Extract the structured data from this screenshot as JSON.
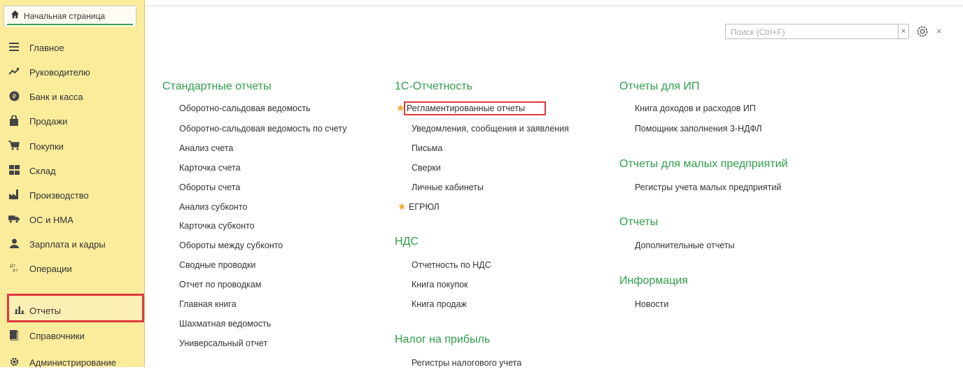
{
  "home_tab": {
    "label": "Начальная страница"
  },
  "sidebar": {
    "items": [
      {
        "label": "Главное",
        "icon": "menu-lines-icon"
      },
      {
        "label": "Руководителю",
        "icon": "trend-icon"
      },
      {
        "label": "Банк и касса",
        "icon": "ruble-coin-icon"
      },
      {
        "label": "Продажи",
        "icon": "shopping-bag-icon"
      },
      {
        "label": "Покупки",
        "icon": "cart-icon"
      },
      {
        "label": "Склад",
        "icon": "warehouse-icon"
      },
      {
        "label": "Производство",
        "icon": "factory-icon"
      },
      {
        "label": "ОС и НМА",
        "icon": "truck-icon"
      },
      {
        "label": "Зарплата и кадры",
        "icon": "person-icon"
      },
      {
        "label": "Операции",
        "icon": "dt-kt-icon"
      },
      {
        "label": "Отчеты",
        "icon": "bar-chart-icon",
        "active": true
      },
      {
        "label": "Справочники",
        "icon": "book-icon"
      },
      {
        "label": "Администрирование",
        "icon": "gear-icon"
      }
    ]
  },
  "search": {
    "placeholder": "Поиск (Ctrl+F)",
    "clear": "×"
  },
  "window": {
    "close": "×"
  },
  "columns": {
    "standard": {
      "title": "Стандартные отчеты",
      "links": [
        "Оборотно-сальдовая ведомость",
        "Оборотно-сальдовая ведомость по счету",
        "Анализ счета",
        "Карточка счета",
        "Обороты счета",
        "Анализ субконто",
        "Карточка субконто",
        "Обороты между субконто",
        "Сводные проводки",
        "Отчет по проводкам",
        "Главная книга",
        "Шахматная ведомость",
        "Универсальный отчет"
      ]
    },
    "reporting": {
      "title": "1С-Отчетность",
      "links": [
        "Регламентированные отчеты",
        "Уведомления, сообщения и заявления",
        "Письма",
        "Сверки",
        "Личные кабинеты",
        "ЕГРЮЛ"
      ]
    },
    "vat": {
      "title": "НДС",
      "links": [
        "Отчетность по НДС",
        "Книга покупок",
        "Книга продаж"
      ]
    },
    "profit": {
      "title": "Налог на прибыль",
      "links": [
        "Регистры налогового учета"
      ]
    },
    "ip": {
      "title": "Отчеты для ИП",
      "links": [
        "Книга доходов и расходов ИП",
        "Помощник заполнения 3-НДФЛ"
      ]
    },
    "small": {
      "title": "Отчеты для малых предприятий",
      "links": [
        "Регистры учета малых предприятий"
      ]
    },
    "other": {
      "title": "Отчеты",
      "links": [
        "Дополнительные отчеты"
      ]
    },
    "info": {
      "title": "Информация",
      "links": [
        "Новости"
      ]
    }
  },
  "colors": {
    "accent": "#2f9e4b",
    "sidebar_bg": "#fbec9c",
    "highlight": "#e0383e",
    "star": "#f4a623"
  }
}
